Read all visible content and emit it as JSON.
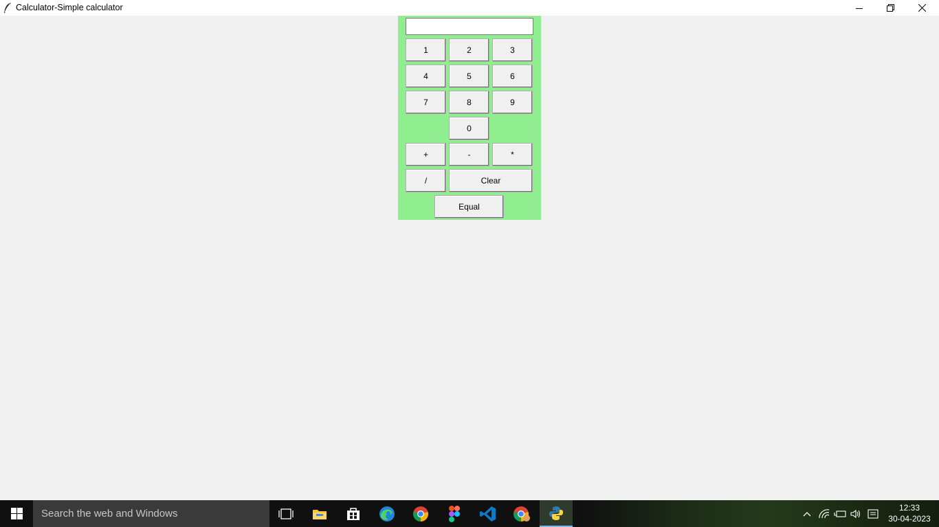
{
  "window": {
    "title": "Calculator-Simple calculator"
  },
  "calculator": {
    "display_value": "",
    "buttons": {
      "b1": "1",
      "b2": "2",
      "b3": "3",
      "b4": "4",
      "b5": "5",
      "b6": "6",
      "b7": "7",
      "b8": "8",
      "b9": "9",
      "b0": "0",
      "plus": "+",
      "minus": "-",
      "multiply": "*",
      "divide": "/",
      "clear": "Clear",
      "equal": "Equal"
    },
    "panel_color": "#90ee90"
  },
  "taskbar": {
    "search_placeholder": "Search the web and Windows",
    "clock_time": "12:33",
    "clock_date": "30-04-2023",
    "apps": [
      "task-view-icon",
      "file-explorer-icon",
      "store-icon",
      "edge-icon",
      "chrome-icon",
      "figma-icon",
      "vscode-icon",
      "chrome-profile-icon",
      "python-icon"
    ]
  }
}
